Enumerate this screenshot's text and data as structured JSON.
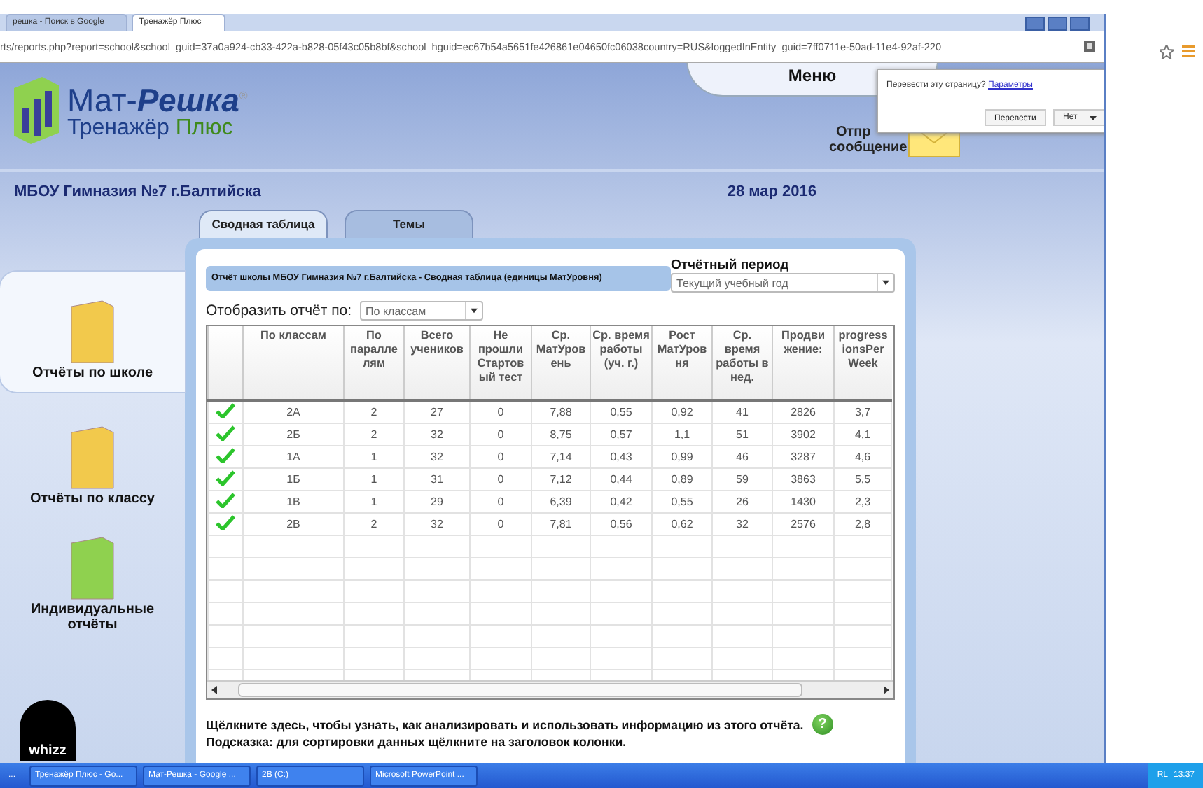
{
  "browser": {
    "tabs": [
      {
        "label": "решка - Поиск в Google",
        "selected": false
      },
      {
        "label": "Тренажёр Плюс",
        "selected": true
      }
    ],
    "url": "rts/reports.php?report=school&school_guid=37a0a924-cb33-422a-b828-05f43c05b8bf&school_hguid=ec67b54a5651fe426861e04650fc06038country=RUS&loggedInEntity_guid=7ff0711e-50ad-11e4-92af-220"
  },
  "logo": {
    "brand_plain": "Мат-",
    "brand_bold": "Решка",
    "reg": "®",
    "sub_plain": "Тренажёр",
    "sub_accent": "Плюс"
  },
  "menu": "Меню",
  "send_message": [
    "Отпр",
    "сообщение"
  ],
  "translate": {
    "question": "Перевести эту страницу?",
    "link": "Параметры",
    "translate_button": "Перевести",
    "no_button": "Нет"
  },
  "school": "МБОУ Гимназия №7 г.Балтийска",
  "date": "28 мар 2016",
  "tabs": [
    {
      "label": "Сводная таблица",
      "selected": true
    },
    {
      "label": "Темы",
      "selected": false
    }
  ],
  "sidebar": [
    {
      "label": "Отчёты по школе",
      "selected": true,
      "color": "#f2c94c"
    },
    {
      "label": "Отчёты по классу",
      "selected": false,
      "color": "#f2c94c"
    },
    {
      "label": "Индивидуальные отчёты",
      "selected": false,
      "color": "#8fd14f"
    }
  ],
  "whizz": "whizz",
  "report": {
    "title": "Отчёт школы МБОУ Гимназия №7 г.Балтийска - Сводная таблица (единицы МатУровня)",
    "period_label": "Отчётный период",
    "period_value": "Текущий учебный год",
    "display_label": "Отобразить отчёт по:",
    "display_value": "По классам"
  },
  "table": {
    "columns": [
      "По классам",
      "По паралле лям",
      "Всего учеников",
      "Не прошли Стартов ый тест",
      "Ср. МатУров ень",
      "Ср. время работы (уч. г.)",
      "Рост МатУров ня",
      "Ср. время работы в нед.",
      "Продви жение:",
      "progress ionsPer Week"
    ],
    "rows": [
      {
        "done": true,
        "cells": [
          "2А",
          "2",
          "27",
          "0",
          "7,88",
          "0,55",
          "0,92",
          "41",
          "2826",
          "3,7"
        ]
      },
      {
        "done": true,
        "cells": [
          "2Б",
          "2",
          "32",
          "0",
          "8,75",
          "0,57",
          "1,1",
          "51",
          "3902",
          "4,1"
        ]
      },
      {
        "done": true,
        "cells": [
          "1А",
          "1",
          "32",
          "0",
          "7,14",
          "0,43",
          "0,99",
          "46",
          "3287",
          "4,6"
        ]
      },
      {
        "done": true,
        "cells": [
          "1Б",
          "1",
          "31",
          "0",
          "7,12",
          "0,44",
          "0,89",
          "59",
          "3863",
          "5,5"
        ]
      },
      {
        "done": true,
        "cells": [
          "1В",
          "1",
          "29",
          "0",
          "6,39",
          "0,42",
          "0,55",
          "26",
          "1430",
          "2,3"
        ]
      },
      {
        "done": true,
        "cells": [
          "2В",
          "2",
          "32",
          "0",
          "7,81",
          "0,56",
          "0,62",
          "32",
          "2576",
          "2,8"
        ]
      }
    ]
  },
  "help_icon": "?",
  "help": "Щёлкните здесь, чтобы узнать, как анализировать и использовать информацию из этого отчёта.",
  "hint": "Подсказка: для сортировки данных щёлкните на заголовок колонки.",
  "taskbar": {
    "start": "...",
    "items": [
      "Тренажёр Плюс - Go...",
      "Мат-Решка - Google ...",
      "2В (C:)",
      "Microsoft PowerPoint ..."
    ],
    "lang": "RL",
    "time": "13:37"
  }
}
